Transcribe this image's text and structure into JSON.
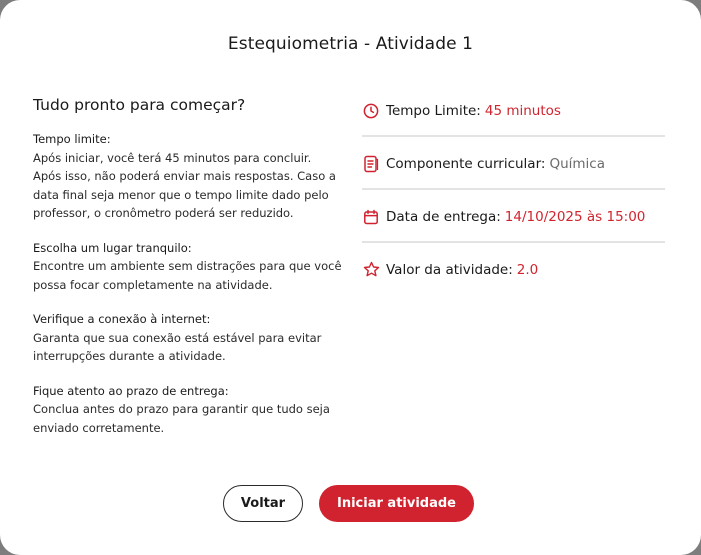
{
  "modal": {
    "title": "Estequiometria - Atividade 1"
  },
  "instructions": {
    "heading": "Tudo pronto para começar?",
    "blocks": [
      {
        "title": "Tempo limite:",
        "body": "Após iniciar, você terá 45 minutos para concluir. Após isso, não poderá enviar mais respostas. Caso a data final seja menor que o tempo limite dado pelo professor, o cronômetro poderá ser reduzido."
      },
      {
        "title": "Escolha um lugar tranquilo:",
        "body": "Encontre um ambiente sem distrações para que você possa focar completamente na atividade."
      },
      {
        "title": "Verifique a conexão à internet:",
        "body": "Garanta que sua conexão está estável para evitar interrupções durante a atividade."
      },
      {
        "title": "Fique atento ao prazo de entrega:",
        "body": "Conclua antes do prazo para garantir que tudo seja enviado corretamente."
      }
    ]
  },
  "info": {
    "time_limit": {
      "label": "Tempo Limite:",
      "value": "45 minutos",
      "icon": "clock-icon"
    },
    "component": {
      "label": "Componente curricular:",
      "value": "Química",
      "icon": "document-icon"
    },
    "due_date": {
      "label": "Data de entrega:",
      "value": "14/10/2025 às 15:00",
      "icon": "calendar-icon"
    },
    "grade": {
      "label": "Valor da atividade:",
      "value": "2.0",
      "icon": "star-icon"
    }
  },
  "actions": {
    "back_label": "Voltar",
    "start_label": "Iniciar atividade"
  },
  "colors": {
    "accent": "#d0232f",
    "backdrop": "#7d7d7d"
  }
}
